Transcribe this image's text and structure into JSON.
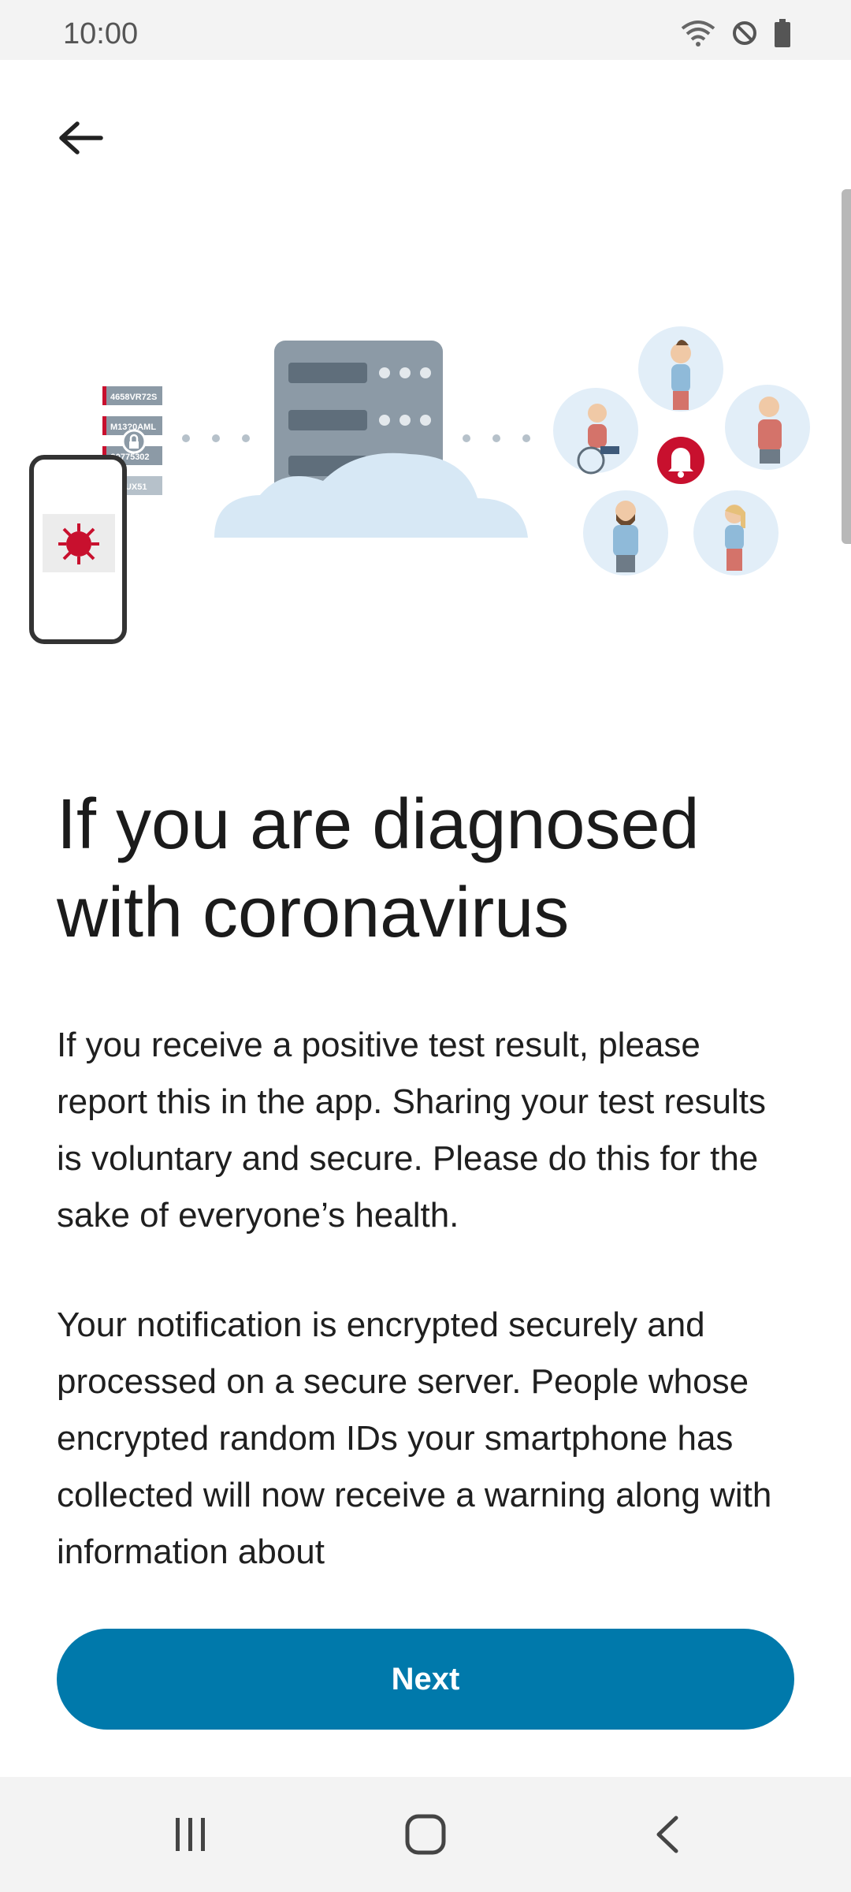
{
  "status_bar": {
    "time": "10:00",
    "icons": [
      "wifi-icon",
      "do-not-disturb-icon",
      "battery-icon"
    ]
  },
  "app_bar": {
    "back_icon": "arrow-left-icon"
  },
  "illustration": {
    "id_labels": [
      "4658VR72S",
      "M13?0AML",
      "?0775302",
      "?40UX51"
    ]
  },
  "content": {
    "title": "If you are diagnosed with coronavirus",
    "paragraph1": "If you receive a positive test result, please report this in the app. Sharing your test results is voluntary and secure. Please do this for the sake of everyone’s health.",
    "paragraph2": "Your notification is encrypted securely and processed on a secure server. People whose encrypted random IDs your smartphone has collected will now receive a warning along with information about"
  },
  "actions": {
    "next_label": "Next"
  },
  "colors": {
    "primary": "#0079ab",
    "alert_red": "#c8102e",
    "server_gray": "#8c9aa6",
    "cloud": "#d7e8f5"
  },
  "nav_bar": {
    "icons": [
      "recent-apps-icon",
      "home-icon",
      "back-nav-icon"
    ]
  }
}
